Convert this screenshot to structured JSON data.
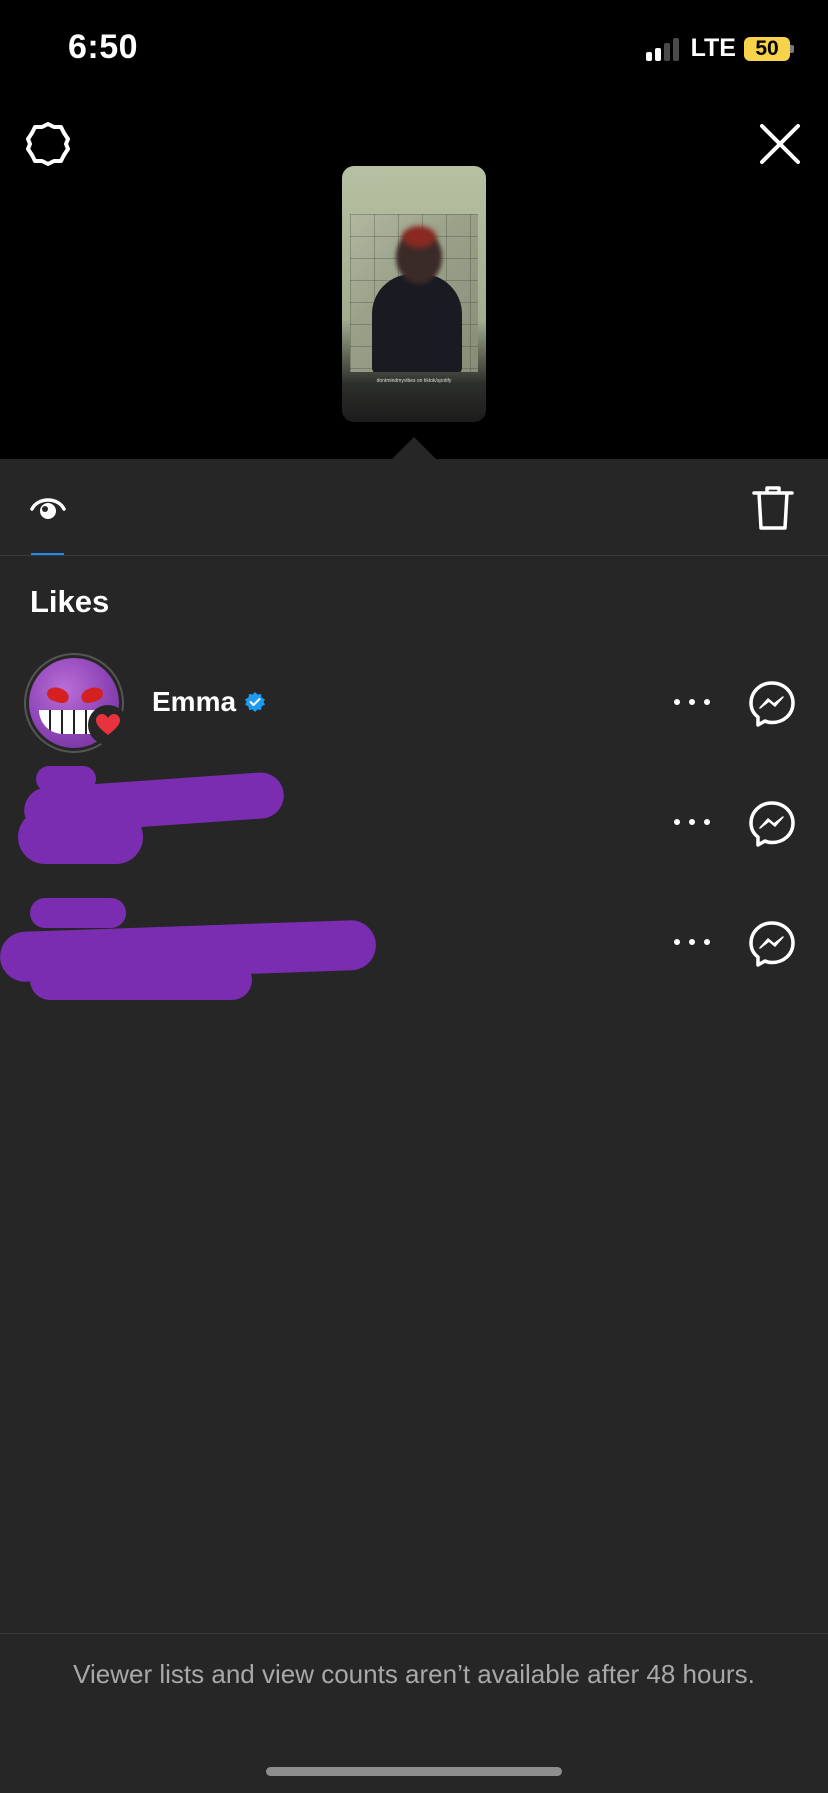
{
  "status_bar": {
    "time": "6:50",
    "network": "LTE",
    "battery": "50"
  },
  "story_preview": {
    "caption": "dontmindmyvibes on tiktok/spotify"
  },
  "toolbar": {
    "viewers_icon": "eye-icon",
    "delete_icon": "trash-icon"
  },
  "likes": {
    "heading": "Likes",
    "items": [
      {
        "name": "Emma",
        "verified": true
      }
    ]
  },
  "footer": {
    "message": "Viewer lists and view counts aren’t available after 48 hours."
  },
  "colors": {
    "accent": "#1d8cf0",
    "background": "#262626",
    "heart": "#e8333f",
    "verified": "#1d9bf0"
  }
}
